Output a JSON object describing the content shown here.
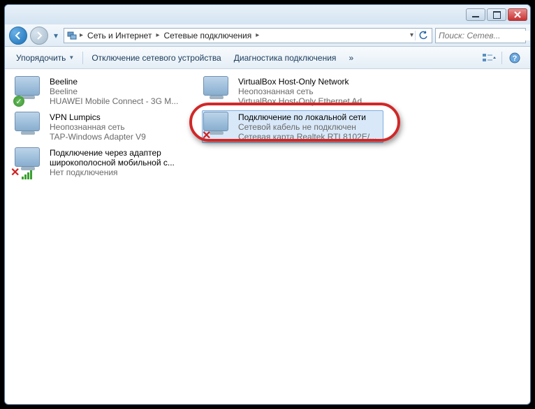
{
  "breadcrumb": {
    "seg1": "Сеть и Интернет",
    "seg2": "Сетевые подключения"
  },
  "search": {
    "placeholder": "Поиск: Сетев..."
  },
  "toolbar": {
    "organize": "Упорядочить",
    "disable": "Отключение сетевого устройства",
    "diagnose": "Диагностика подключения",
    "more": "»"
  },
  "items": [
    {
      "l1": "Beeline",
      "l2": "Beeline",
      "l3": "HUAWEI Mobile Connect - 3G M...",
      "badge": "check"
    },
    {
      "l1": "VirtualBox Host-Only Network",
      "l2": "Неопознанная сеть",
      "l3": "VirtualBox Host-Only Ethernet Ad...",
      "badge": "none"
    },
    {
      "l1": "VPN Lumpics",
      "l2": "Неопознанная сеть",
      "l3": "TAP-Windows Adapter V9",
      "badge": "none"
    },
    {
      "l1": "Подключение по локальной сети",
      "l2": "Сетевой кабель не подключен",
      "l3": "Сетевая карта Realtek RTL8102E/...",
      "badge": "x",
      "selected": true
    },
    {
      "l1": "Подключение через адаптер широкополосной мобильной с...",
      "l2": "Нет подключения",
      "l3": "",
      "badge": "bars-x"
    }
  ]
}
